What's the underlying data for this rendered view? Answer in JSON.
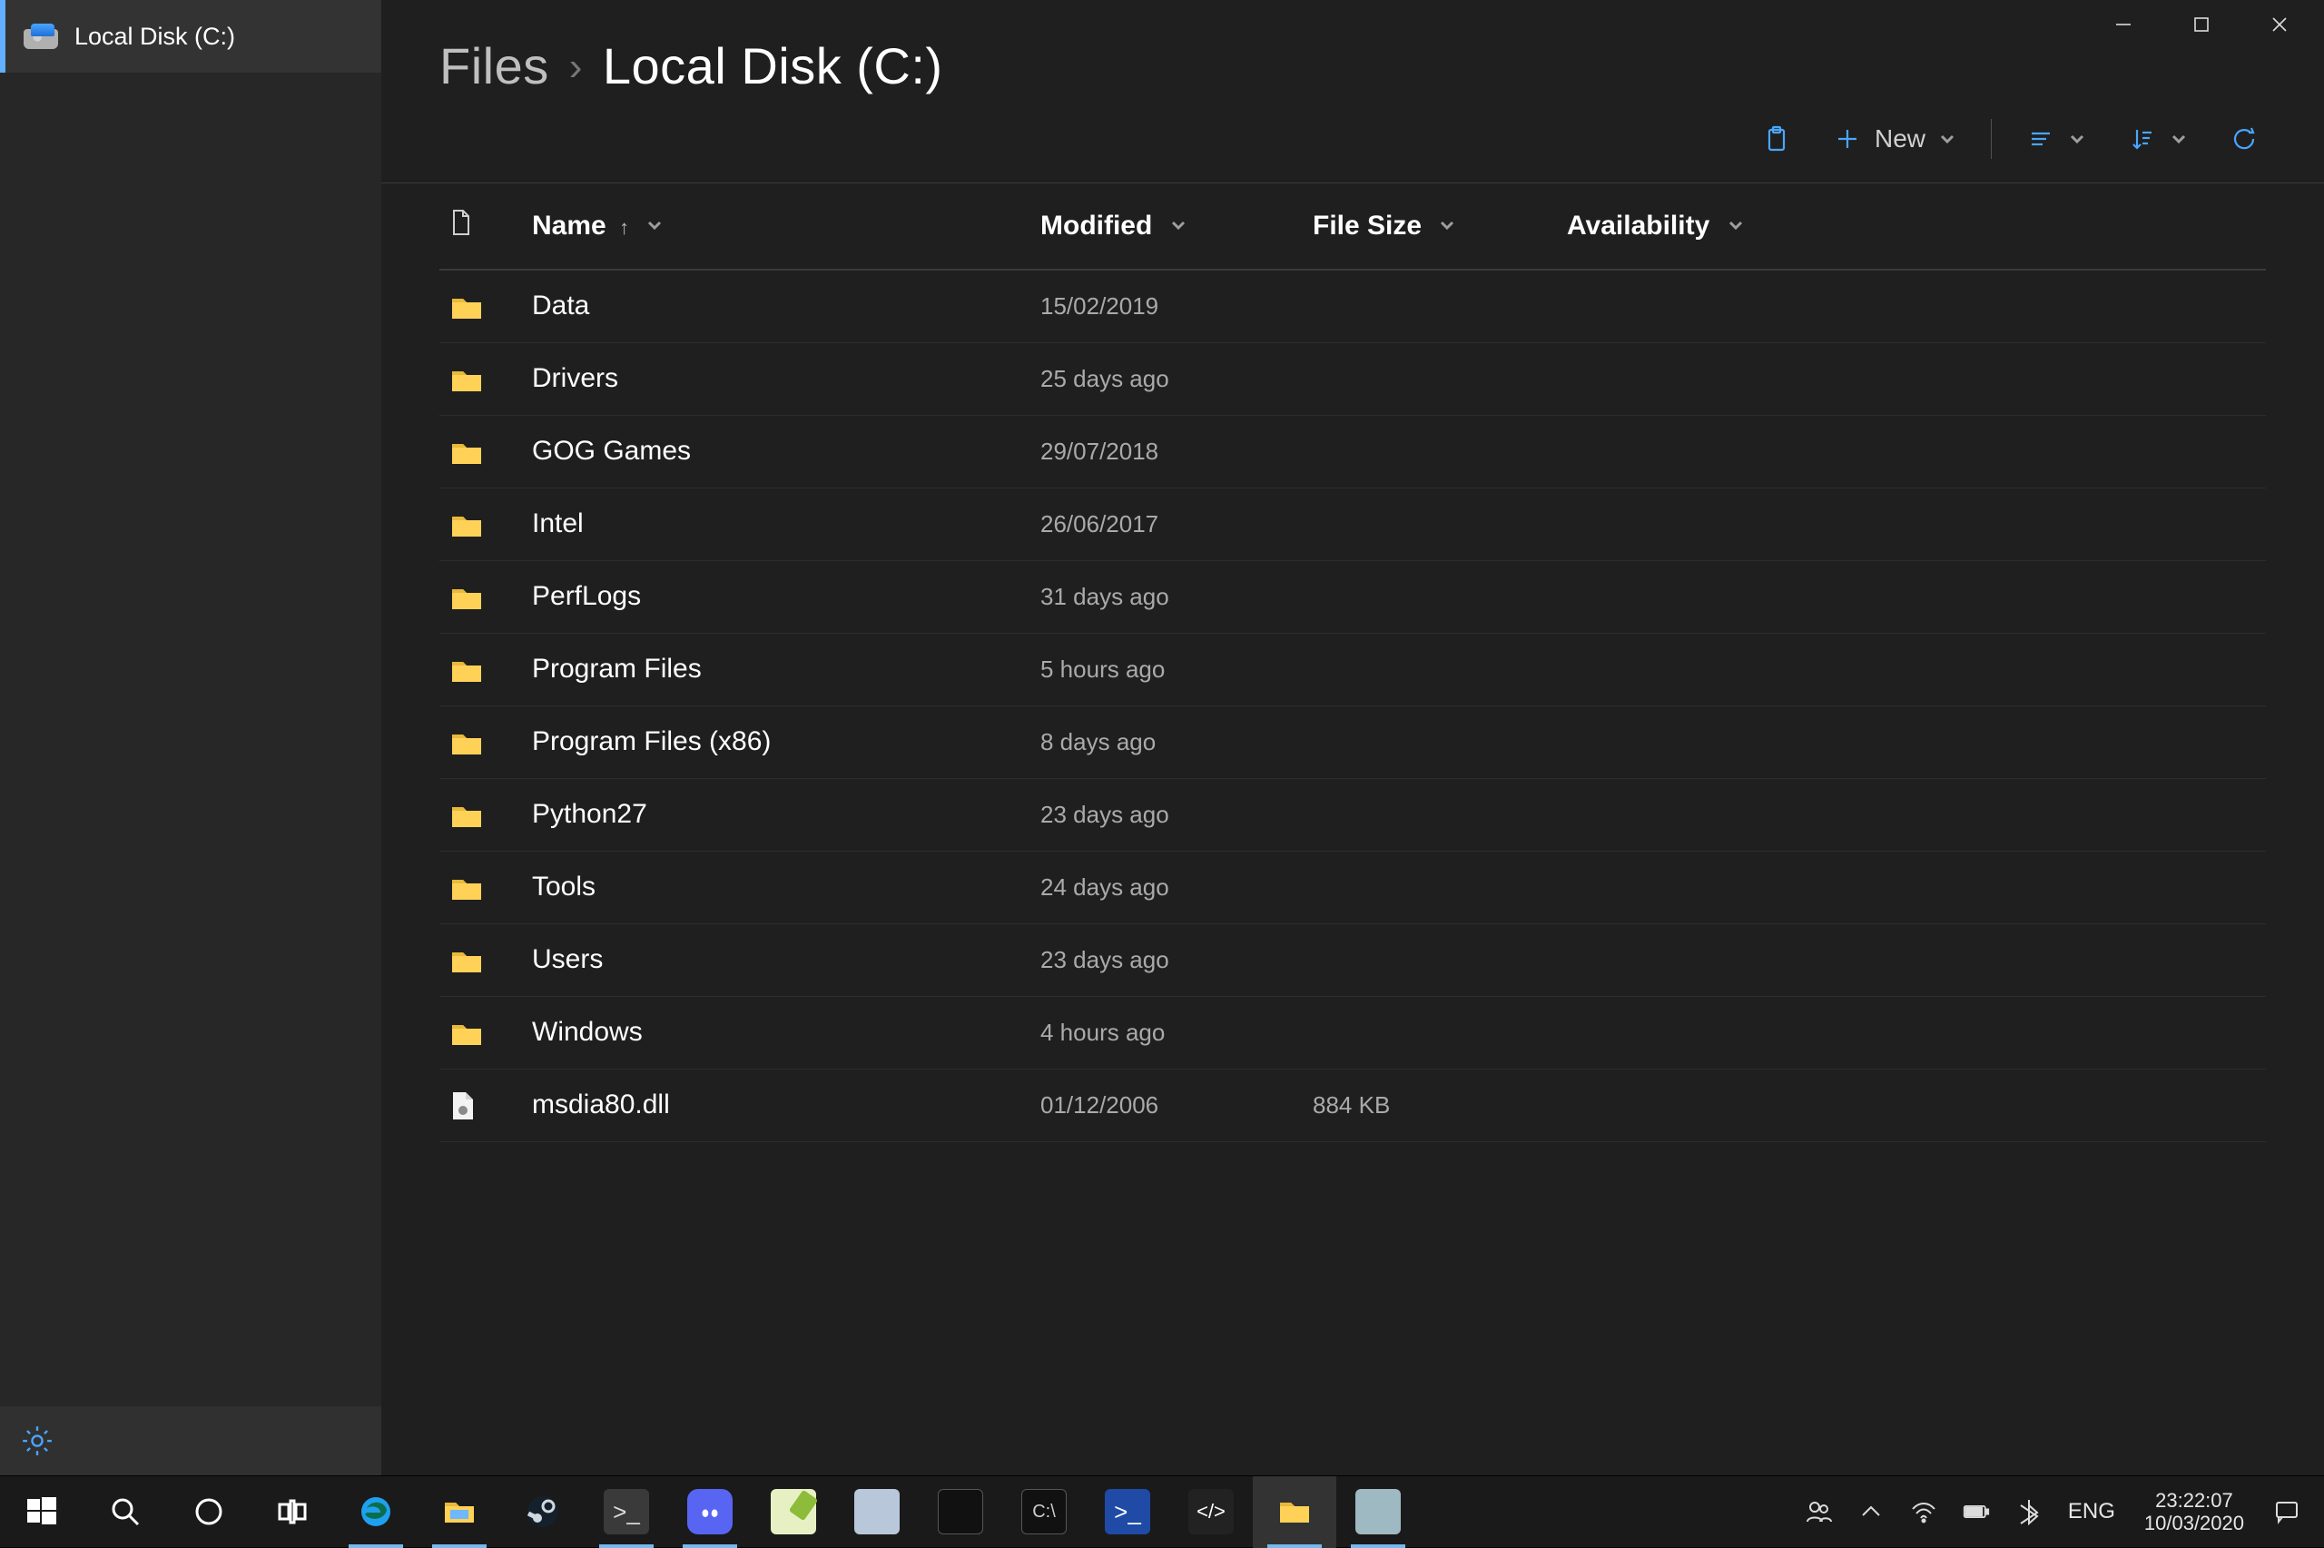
{
  "window": {
    "sidebar": {
      "active_tab_label": "Local Disk (C:)"
    },
    "breadcrumb": {
      "root": "Files",
      "current": "Local Disk (C:)"
    },
    "toolbar": {
      "new_label": "New"
    },
    "columns": {
      "name": "Name",
      "modified": "Modified",
      "file_size": "File Size",
      "availability": "Availability"
    },
    "rows": [
      {
        "type": "folder",
        "name": "Data",
        "modified": "15/02/2019",
        "size": "",
        "availability": ""
      },
      {
        "type": "folder",
        "name": "Drivers",
        "modified": "25 days ago",
        "size": "",
        "availability": ""
      },
      {
        "type": "folder",
        "name": "GOG Games",
        "modified": "29/07/2018",
        "size": "",
        "availability": ""
      },
      {
        "type": "folder",
        "name": "Intel",
        "modified": "26/06/2017",
        "size": "",
        "availability": ""
      },
      {
        "type": "folder",
        "name": "PerfLogs",
        "modified": "31 days ago",
        "size": "",
        "availability": ""
      },
      {
        "type": "folder",
        "name": "Program Files",
        "modified": "5 hours ago",
        "size": "",
        "availability": ""
      },
      {
        "type": "folder",
        "name": "Program Files (x86)",
        "modified": "8 days ago",
        "size": "",
        "availability": ""
      },
      {
        "type": "folder",
        "name": "Python27",
        "modified": "23 days ago",
        "size": "",
        "availability": ""
      },
      {
        "type": "folder",
        "name": "Tools",
        "modified": "24 days ago",
        "size": "",
        "availability": ""
      },
      {
        "type": "folder",
        "name": "Users",
        "modified": "23 days ago",
        "size": "",
        "availability": ""
      },
      {
        "type": "folder",
        "name": "Windows",
        "modified": "4 hours ago",
        "size": "",
        "availability": ""
      },
      {
        "type": "file",
        "name": "msdia80.dll",
        "modified": "01/12/2006",
        "size": "884 KB",
        "availability": ""
      }
    ]
  },
  "taskbar": {
    "language": "ENG",
    "time": "23:22:07",
    "date": "10/03/2020"
  }
}
